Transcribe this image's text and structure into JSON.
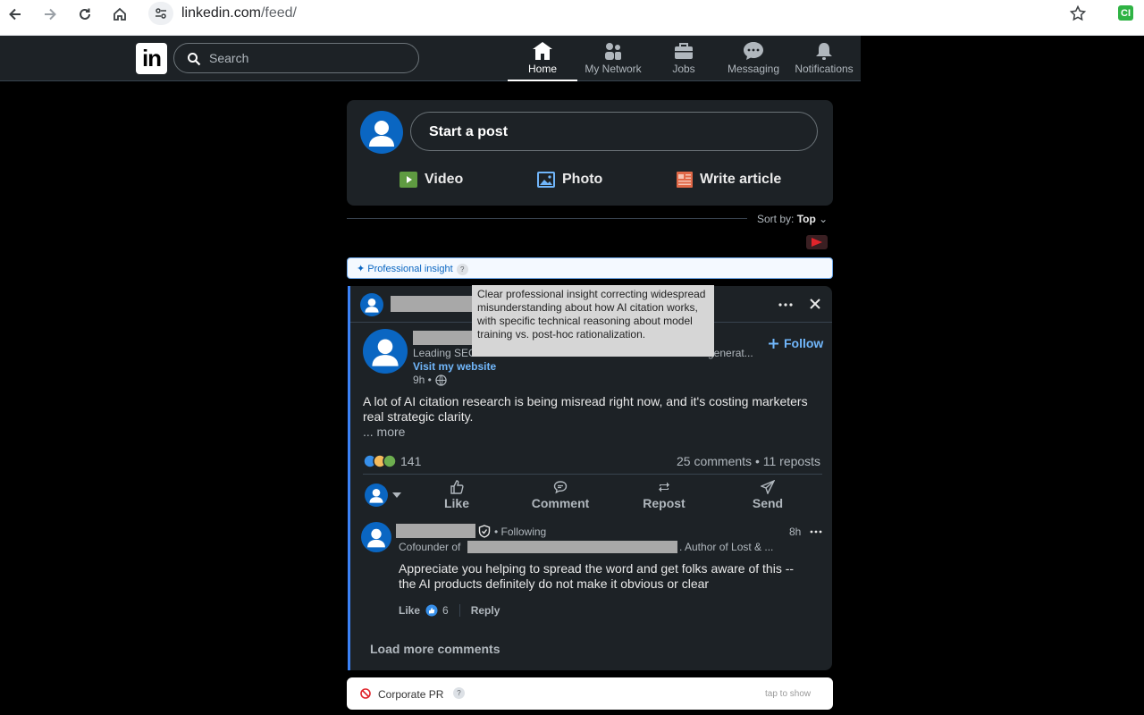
{
  "browser": {
    "url_domain": "linkedin.com",
    "url_path": "/feed/",
    "extension_label": "CI"
  },
  "header": {
    "logo": "in",
    "search_placeholder": "Search",
    "nav": [
      {
        "label": "Home",
        "icon": "home-icon",
        "active": true
      },
      {
        "label": "My Network",
        "icon": "network-icon"
      },
      {
        "label": "Jobs",
        "icon": "briefcase-icon"
      },
      {
        "label": "Messaging",
        "icon": "messaging-icon"
      },
      {
        "label": "Notifications",
        "icon": "bell-icon"
      }
    ]
  },
  "composer": {
    "start_post": "Start a post",
    "video": "Video",
    "photo": "Photo",
    "write_article": "Write article",
    "colors": {
      "video": "#5f9b41",
      "photo": "#70b5f9",
      "article": "#e06847"
    }
  },
  "sort": {
    "label": "Sort by:",
    "value": "Top"
  },
  "insight_bar": {
    "label": "✦ Professional insight",
    "help": "?"
  },
  "tooltip": {
    "text": "Clear professional insight correcting widespread misunderstanding about how AI citation works, with specific technical reasoning about model training vs. post-hoc rationalization."
  },
  "post": {
    "author_headline_start": "Leading SEO",
    "author_headline_end": "generat...",
    "visit_website": "Visit my website",
    "time": "9h •",
    "follow": "Follow",
    "body_line1": "A lot of AI citation research is being misread right now, and it's costing marketers",
    "body_line2": "real strategic clarity.",
    "more": "... more",
    "reactions_count": "141",
    "comments": "25 comments",
    "reposts": "• 11 reposts",
    "actions": {
      "like": "Like",
      "comment": "Comment",
      "repost": "Repost",
      "send": "Send"
    }
  },
  "comment": {
    "following": "• Following",
    "time": "8h",
    "headline_start": "Cofounder of",
    "headline_end": ". Author of Lost & ...",
    "text_line1": "Appreciate you helping to spread the word and get folks aware of this --",
    "text_line2": "the AI products definitely do not make it obvious or clear",
    "like": "Like",
    "like_count": "6",
    "reply": "Reply"
  },
  "load_more": "Load more comments",
  "corporate_bar": {
    "label": "Corporate PR",
    "help": "?",
    "hint": "tap to show"
  }
}
